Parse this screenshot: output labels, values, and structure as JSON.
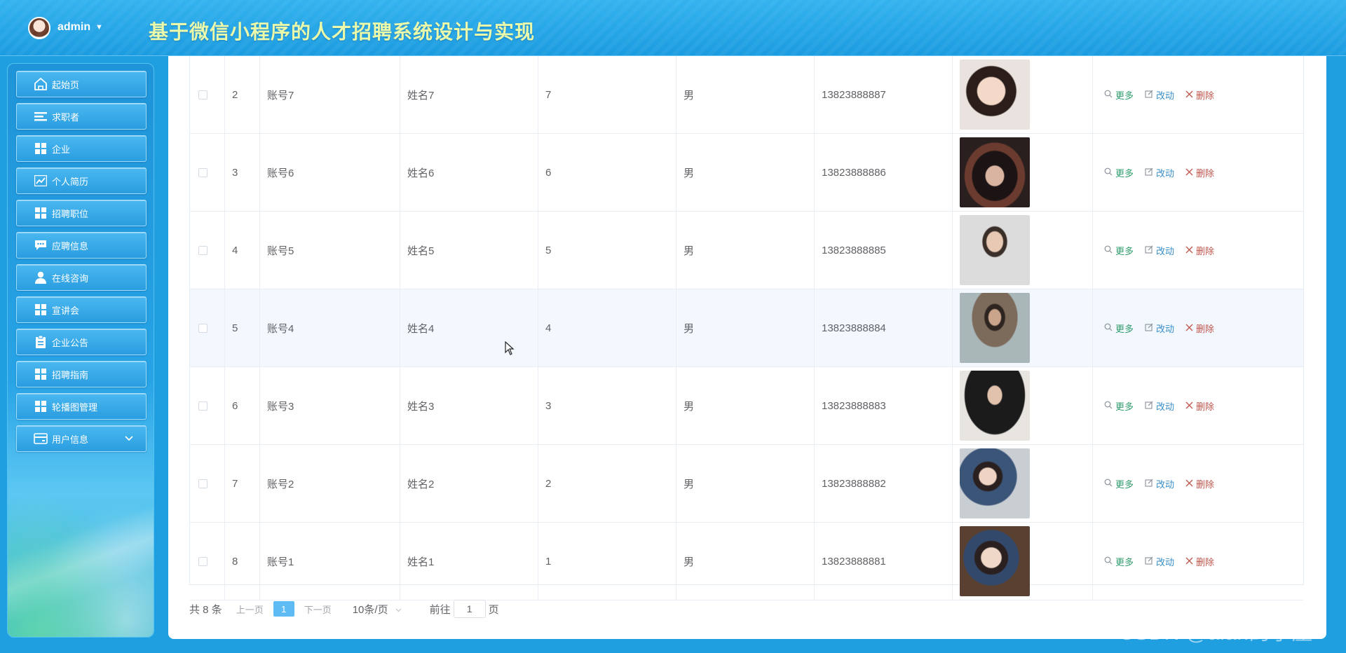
{
  "header": {
    "user": "admin",
    "title": "基于微信小程序的人才招聘系统设计与实现"
  },
  "sidebar": {
    "items": [
      {
        "label": "起始页",
        "icon": "home-icon"
      },
      {
        "label": "求职者",
        "icon": "list-icon"
      },
      {
        "label": "企业",
        "icon": "grid-icon"
      },
      {
        "label": "个人简历",
        "icon": "chart-icon"
      },
      {
        "label": "招聘职位",
        "icon": "grid-icon"
      },
      {
        "label": "应聘信息",
        "icon": "message-icon"
      },
      {
        "label": "在线咨询",
        "icon": "user-icon"
      },
      {
        "label": "宣讲会",
        "icon": "grid-icon"
      },
      {
        "label": "企业公告",
        "icon": "clipboard-icon"
      },
      {
        "label": "招聘指南",
        "icon": "grid-icon"
      },
      {
        "label": "轮播图管理",
        "icon": "grid-icon"
      },
      {
        "label": "用户信息",
        "icon": "card-icon"
      }
    ]
  },
  "table": {
    "rows": [
      {
        "index": "2",
        "account": "账号7",
        "name": "姓名7",
        "num": "7",
        "gender": "男",
        "phone": "13823888887"
      },
      {
        "index": "3",
        "account": "账号6",
        "name": "姓名6",
        "num": "6",
        "gender": "男",
        "phone": "13823888886"
      },
      {
        "index": "4",
        "account": "账号5",
        "name": "姓名5",
        "num": "5",
        "gender": "男",
        "phone": "13823888885"
      },
      {
        "index": "5",
        "account": "账号4",
        "name": "姓名4",
        "num": "4",
        "gender": "男",
        "phone": "13823888884"
      },
      {
        "index": "6",
        "account": "账号3",
        "name": "姓名3",
        "num": "3",
        "gender": "男",
        "phone": "13823888883"
      },
      {
        "index": "7",
        "account": "账号2",
        "name": "姓名2",
        "num": "2",
        "gender": "男",
        "phone": "13823888882"
      },
      {
        "index": "8",
        "account": "账号1",
        "name": "姓名1",
        "num": "1",
        "gender": "男",
        "phone": "13823888881"
      }
    ],
    "actions": {
      "more": "更多",
      "edit": "改动",
      "delete": "删除"
    }
  },
  "pagination": {
    "total": "共 8 条",
    "prev": "上一页",
    "current": "1",
    "next": "下一页",
    "page_size": "10条/页",
    "goto_prefix": "前往",
    "goto_value": "1",
    "goto_suffix": "页"
  },
  "watermark": "CSDN @alan的小屋"
}
